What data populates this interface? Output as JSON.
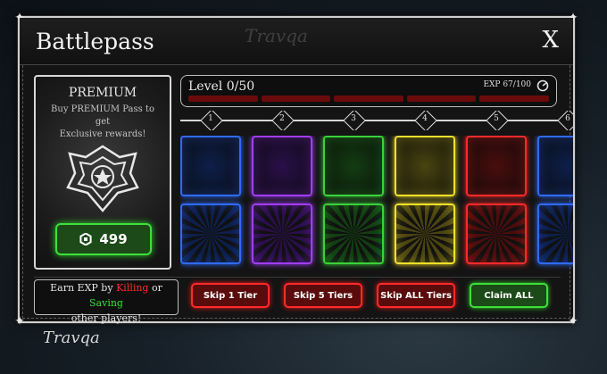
{
  "window": {
    "title": "Battlepass",
    "close_label": "X"
  },
  "premium": {
    "title": "PREMIUM",
    "description_line1": "Buy PREMIUM Pass to get",
    "description_line2": "Exclusive rewards!",
    "price": "499",
    "icon": "robux-icon"
  },
  "progress": {
    "level_text": "Level 0/50",
    "exp_text": "EXP 67/100",
    "exp_fraction": 0.67,
    "segment_count": 5
  },
  "tiers": [
    "1",
    "2",
    "3",
    "4",
    "5",
    "6"
  ],
  "tier_colors": [
    {
      "name": "blue",
      "border": "#2f6bff",
      "fill": "#0d1f4a"
    },
    {
      "name": "purple",
      "border": "#a23cff",
      "fill": "#2a0f4a"
    },
    {
      "name": "green",
      "border": "#3ad13a",
      "fill": "#133d12"
    },
    {
      "name": "yellow",
      "border": "#f2e02a",
      "fill": "#4a4410"
    },
    {
      "name": "red",
      "border": "#ff2a2a",
      "fill": "#4a0d0d"
    },
    {
      "name": "blue",
      "border": "#2f6bff",
      "fill": "#0d1f4a"
    }
  ],
  "footer": {
    "earn_prefix": "Earn EXP by",
    "earn_kill": "Killing",
    "earn_or": "or",
    "earn_save": "Saving",
    "earn_suffix": "other players!",
    "buttons": [
      {
        "label": "Skip 1 Tier",
        "style": "red"
      },
      {
        "label": "Skip 5 Tiers",
        "style": "red"
      },
      {
        "label": "Skip ALL Tiers",
        "style": "red"
      },
      {
        "label": "Claim ALL",
        "style": "green"
      }
    ]
  },
  "brand": {
    "watermark": "Travqa",
    "logo": "Travqa"
  }
}
